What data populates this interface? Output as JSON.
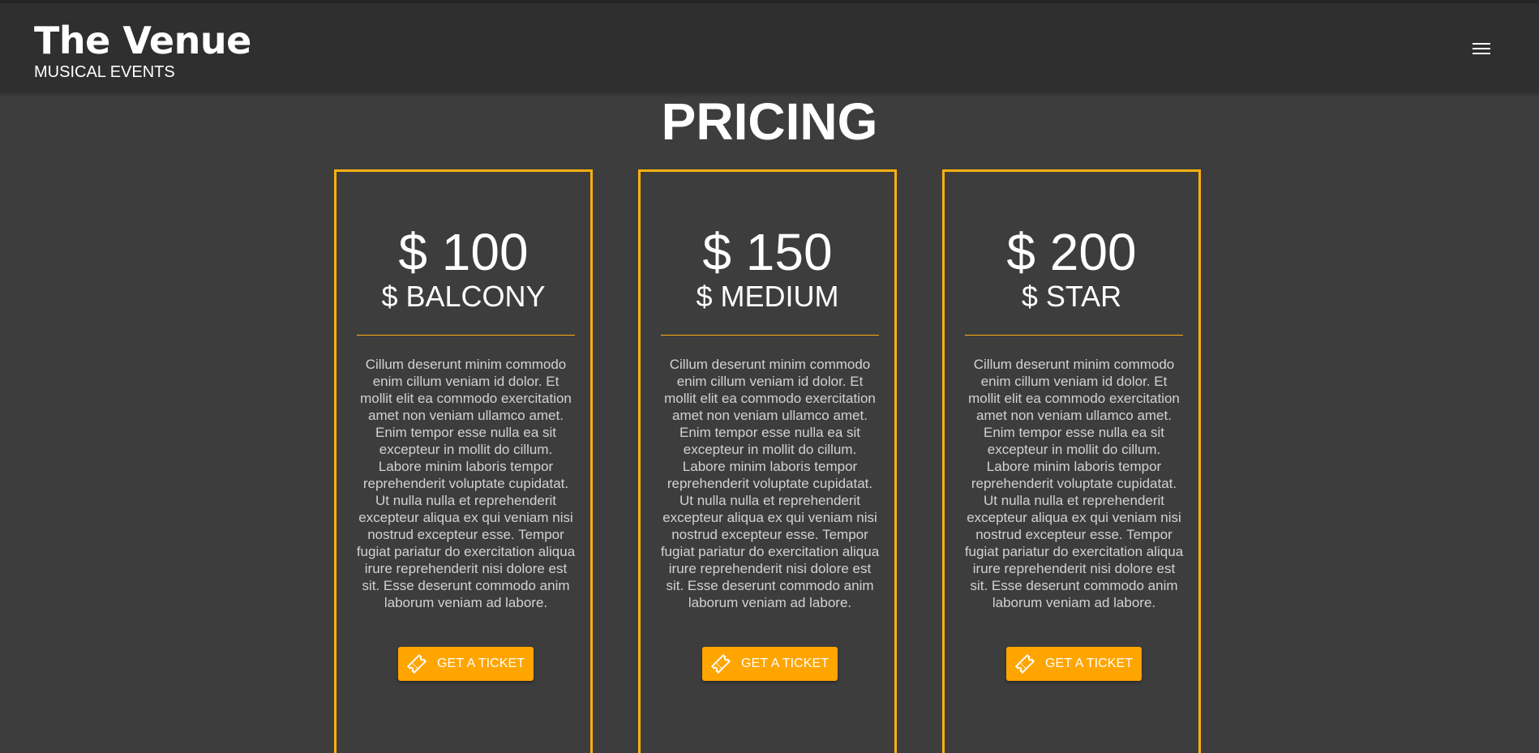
{
  "header": {
    "title": "The Venue",
    "subtitle": "MUSICAL EVENTS",
    "menu_icon": "hamburger-menu-icon"
  },
  "page": {
    "heading": "PRICING"
  },
  "colors": {
    "accent": "#fdb00f",
    "button": "#ffa500",
    "background": "#3d3d3d",
    "header_bg": "#2f2f2f"
  },
  "pricing": {
    "cards": [
      {
        "price": "$ 100",
        "tier": "$ BALCONY",
        "description": "Cillum deserunt minim commodo enim cillum veniam id dolor. Et mollit elit ea commodo exercitation amet non veniam ullamco amet. Enim tempor esse nulla ea sit excepteur in mollit do cillum. Labore minim laboris tempor reprehenderit voluptate cupidatat. Ut nulla nulla et reprehenderit excepteur aliqua ex qui veniam nisi nostrud excepteur esse. Tempor fugiat pariatur do exercitation aliqua irure reprehenderit nisi dolore est sit. Esse deserunt commodo anim laborum veniam ad labore.",
        "button_label": "GET A TICKET",
        "button_icon": "ticket-icon"
      },
      {
        "price": "$ 150",
        "tier": "$ MEDIUM",
        "description": "Cillum deserunt minim commodo enim cillum veniam id dolor. Et mollit elit ea commodo exercitation amet non veniam ullamco amet. Enim tempor esse nulla ea sit excepteur in mollit do cillum. Labore minim laboris tempor reprehenderit voluptate cupidatat. Ut nulla nulla et reprehenderit excepteur aliqua ex qui veniam nisi nostrud excepteur esse. Tempor fugiat pariatur do exercitation aliqua irure reprehenderit nisi dolore est sit. Esse deserunt commodo anim laborum veniam ad labore.",
        "button_label": "GET A TICKET",
        "button_icon": "ticket-icon"
      },
      {
        "price": "$ 200",
        "tier": "$ STAR",
        "description": "Cillum deserunt minim commodo enim cillum veniam id dolor. Et mollit elit ea commodo exercitation amet non veniam ullamco amet. Enim tempor esse nulla ea sit excepteur in mollit do cillum. Labore minim laboris tempor reprehenderit voluptate cupidatat. Ut nulla nulla et reprehenderit excepteur aliqua ex qui veniam nisi nostrud excepteur esse. Tempor fugiat pariatur do exercitation aliqua irure reprehenderit nisi dolore est sit. Esse deserunt commodo anim laborum veniam ad labore.",
        "button_label": "GET A TICKET",
        "button_icon": "ticket-icon"
      }
    ]
  }
}
